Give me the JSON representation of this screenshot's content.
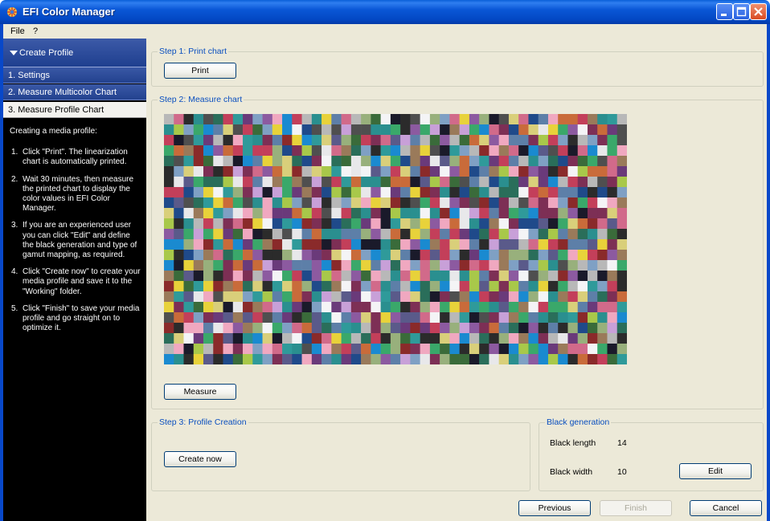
{
  "window": {
    "title": "EFI Color Manager",
    "colors": {
      "titlebar": "#0a57d6",
      "sidebar_bg": "#000000",
      "accent": "#0a4fbf"
    }
  },
  "menu": {
    "items": [
      "File",
      "?"
    ]
  },
  "sidebar": {
    "header": "Create Profile",
    "items": [
      {
        "label": "1. Settings",
        "state": "done"
      },
      {
        "label": "2. Measure Multicolor Chart",
        "state": "done"
      },
      {
        "label": "3. Measure Profile Chart",
        "state": "active"
      }
    ],
    "help_intro": "Creating a media profile:",
    "help_steps": [
      {
        "num": "1.",
        "text": "Click \"Print\". The linearization chart is automatically printed."
      },
      {
        "num": "2.",
        "text": "Wait 30 minutes, then measure the printed chart to display the color values in EFI Color Manager."
      },
      {
        "num": "3.",
        "text": "If you are an experienced user you can click \"Edit\" and define the black generation and type of gamut mapping, as required."
      },
      {
        "num": "4.",
        "text": "Click \"Create now\" to create your media profile and save it to the \"Working\" folder."
      },
      {
        "num": "5.",
        "text": "Click \"Finish\" to save your media profile and go straight on to optimize it."
      }
    ]
  },
  "step1": {
    "legend": "Step 1: Print chart",
    "print_label": "Print"
  },
  "step2": {
    "legend": "Step 2: Measure chart",
    "measure_label": "Measure",
    "chart": {
      "columns": 47,
      "rows": 24,
      "palette": [
        "#7d2f55",
        "#3a6b3a",
        "#c33f5a",
        "#2b2b2b",
        "#5d7fa8",
        "#98b07c",
        "#d9cf7a",
        "#2a8f8f",
        "#8c5aa0",
        "#1f4a8a",
        "#c96b3a",
        "#e8e8ea",
        "#7fa0c4",
        "#4f4f4f",
        "#b8b8b8",
        "#2a6e5a",
        "#d16a8a",
        "#6a3a7a",
        "#a8c84a",
        "#1a8ad0",
        "#e8d23a",
        "#8a2a2a",
        "#3aa86a",
        "#f0a8c0",
        "#5a5a8a",
        "#c8a0d8",
        "#2f9a9a",
        "#9a7a5a",
        "#f4f4f6",
        "#1a1a2a"
      ]
    }
  },
  "step3": {
    "legend": "Step 3: Profile Creation",
    "create_label": "Create now"
  },
  "black_generation": {
    "legend": "Black generation",
    "length_label": "Black length",
    "length_value": "14",
    "width_label": "Black width",
    "width_value": "10",
    "edit_label": "Edit"
  },
  "footer": {
    "previous": "Previous",
    "finish": "Finish",
    "cancel": "Cancel"
  }
}
